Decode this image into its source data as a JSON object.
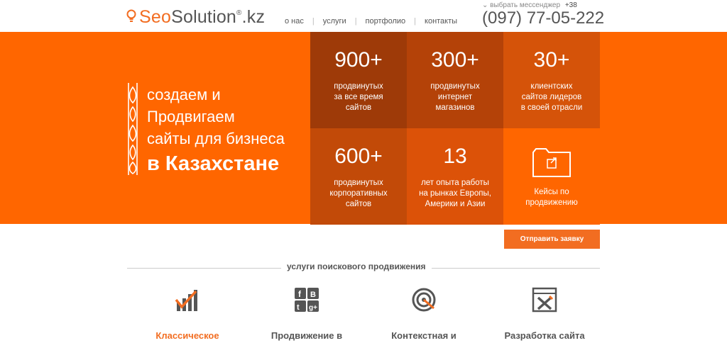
{
  "header": {
    "logo": {
      "part1": "Seo",
      "part2": "Solution",
      "reg": "®",
      "tld": ".kz"
    },
    "nav": [
      {
        "label": "о нас"
      },
      {
        "label": "услуги"
      },
      {
        "label": "портфолио"
      },
      {
        "label": "контакты"
      }
    ],
    "messenger": {
      "label": "выбрать мессенджер",
      "code": "+38"
    },
    "phone": "(097) 77-05-222"
  },
  "hero": {
    "line1": "создаем и",
    "line2": "Продвигаем",
    "line3": "сайты для бизнеса",
    "line4": "в Казахстане"
  },
  "stats": [
    {
      "number": "900+",
      "text": [
        "продвинутых",
        "за все время",
        "сайтов"
      ]
    },
    {
      "number": "300+",
      "text": [
        "продвинутых",
        "интернет",
        "магазинов"
      ]
    },
    {
      "number": "30+",
      "text": [
        "клиентских",
        "сайтов лидеров",
        "в своей отрасли"
      ]
    },
    {
      "number": "600+",
      "text": [
        "продвинутых",
        "корпоративных",
        "сайтов"
      ]
    },
    {
      "number": "13",
      "text": [
        "лет опыта работы",
        "на рынках Европы,",
        "Америки и Азии"
      ]
    },
    {
      "number": "",
      "text": [
        "Кейсы по",
        "продвижению"
      ]
    }
  ],
  "cta": {
    "label": "Отправить заявку"
  },
  "services": {
    "heading": "услуги поискового продвижения",
    "items": [
      {
        "label": "Классическое",
        "icon": "chart-up-icon",
        "active": true
      },
      {
        "label": "Продвижение в",
        "icon": "social-networks-icon",
        "active": false
      },
      {
        "label": "Контекстная и",
        "icon": "target-icon",
        "active": false
      },
      {
        "label": "Разработка сайта",
        "icon": "tools-icon",
        "active": false
      }
    ]
  },
  "colors": {
    "accent": "#f26d21",
    "hero": "#ff6600"
  }
}
